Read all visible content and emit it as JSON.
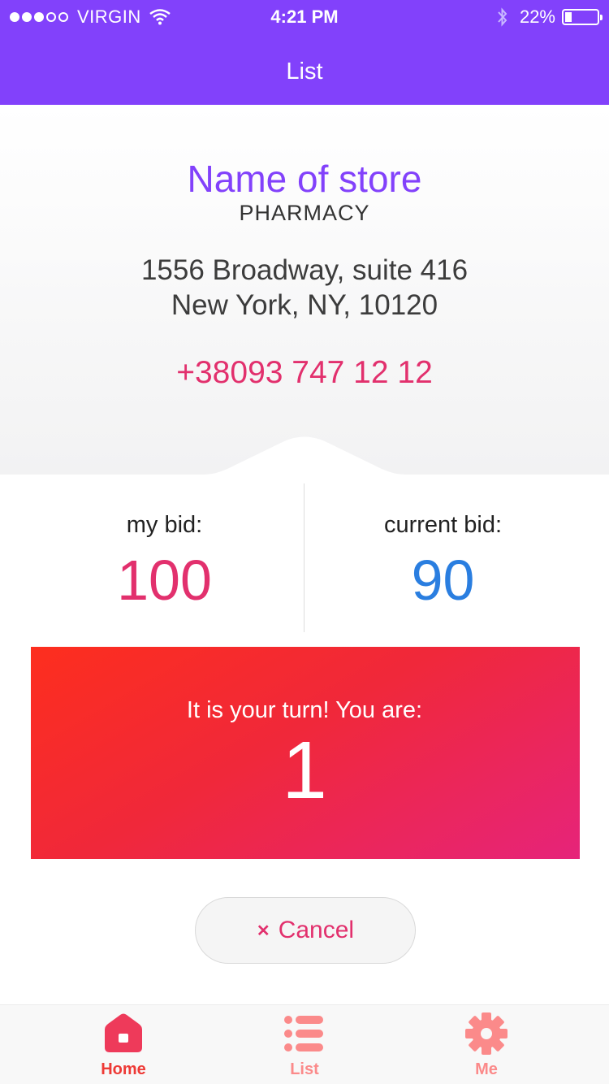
{
  "status_bar": {
    "carrier": "VIRGIN",
    "time": "4:21 PM",
    "battery_percent": "22%",
    "battery_level": 0.22,
    "signal_bars_filled": 3,
    "signal_bars_total": 5
  },
  "nav": {
    "title": "List"
  },
  "store": {
    "name": "Name of store",
    "type": "PHARMACY",
    "address_line1": "1556 Broadway, suite 416",
    "address_line2": "New York, NY, 10120",
    "phone": "+38093 747 12 12"
  },
  "bids": {
    "my_bid_label": "my bid:",
    "my_bid_value": "100",
    "current_bid_label": "current bid:",
    "current_bid_value": "90"
  },
  "turn": {
    "message": "It is your turn! You are:",
    "position": "1"
  },
  "cancel": {
    "icon": "close-icon",
    "label": "Cancel"
  },
  "tabs": [
    {
      "label": "Home",
      "icon": "home-icon",
      "active": true
    },
    {
      "label": "List",
      "icon": "list-icon",
      "active": false
    },
    {
      "label": "Me",
      "icon": "gear-icon",
      "active": false
    }
  ],
  "colors": {
    "brand_purple": "#8241fb",
    "accent_pink": "#e2306d",
    "current_bid_blue": "#2a7ee0",
    "turn_gradient_start": "#fd2e1e",
    "turn_gradient_end": "#e6247a"
  }
}
